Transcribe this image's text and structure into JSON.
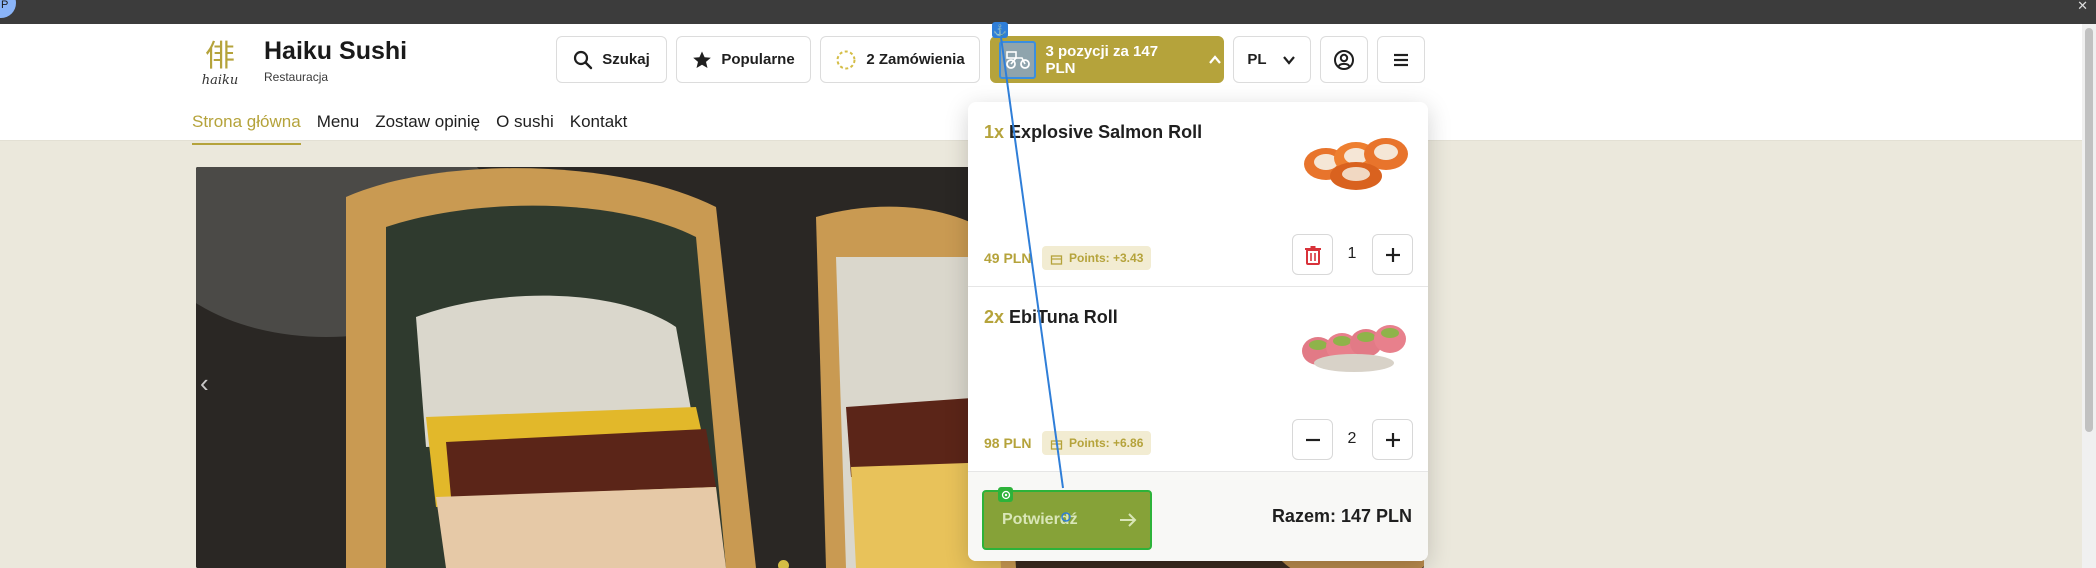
{
  "browser": {
    "avatar_letter": "P",
    "close_glyph": "✕"
  },
  "brand": {
    "name": "Haiku Sushi",
    "subtitle": "Restauracja",
    "logo_text": "haiku"
  },
  "header": {
    "search_label": "Szukaj",
    "popular_label": "Popularne",
    "orders_label": "2 Zamówienia",
    "cart_label": "3 pozycji za 147 PLN",
    "language": "PL",
    "accent_color": "#b5a33b"
  },
  "nav": {
    "items": [
      {
        "label": "Strona główna",
        "active": true
      },
      {
        "label": "Menu"
      },
      {
        "label": "Zostaw opinię"
      },
      {
        "label": "O sushi"
      },
      {
        "label": "Kontakt"
      }
    ]
  },
  "hero": {
    "prev_glyph": "‹"
  },
  "cart_popup": {
    "items": [
      {
        "qty": "1x",
        "name": "Explosive Salmon Roll",
        "price": "49 PLN",
        "points": "Points: +3.43",
        "count": "1",
        "minus_icon": "trash-icon"
      },
      {
        "qty": "2x",
        "name": "EbiTuna Roll",
        "price": "98 PLN",
        "points": "Points: +6.86",
        "count": "2",
        "minus_icon": "minus-icon"
      }
    ],
    "confirm_label": "Potwierdź",
    "total": "Razem: 147 PLN"
  },
  "overlay": {
    "anchor_glyph": "⚓"
  }
}
